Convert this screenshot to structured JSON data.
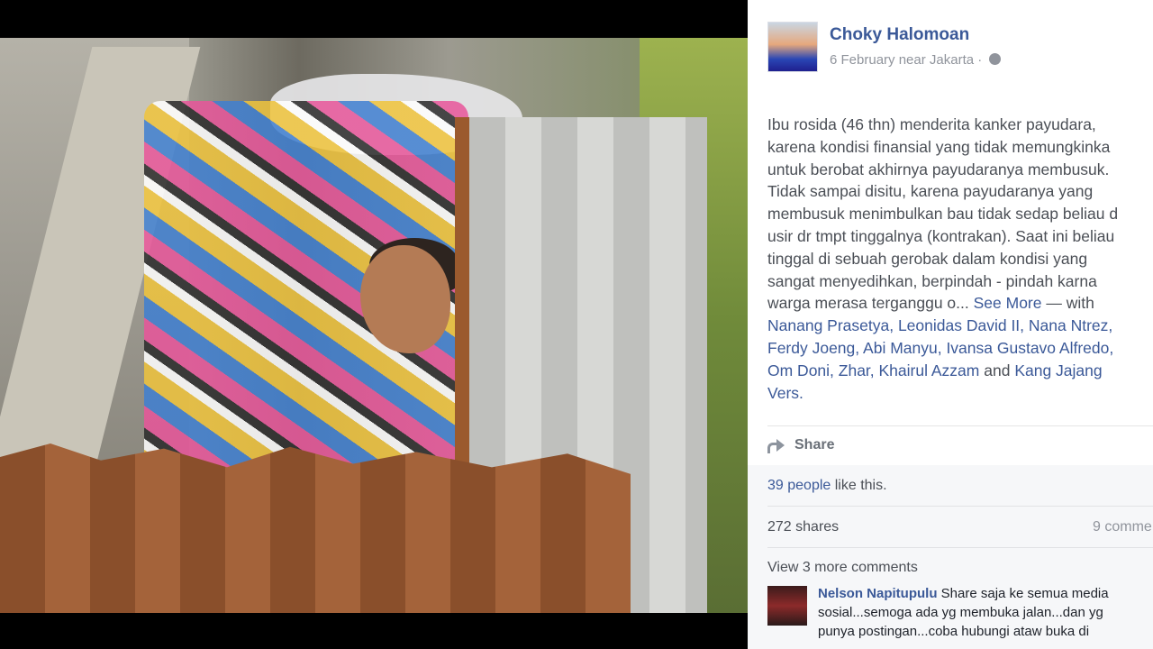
{
  "post": {
    "author": "Choky Halomoan",
    "meta": "6 February near Jakarta ·",
    "icon": "globe-icon",
    "text_lines": [
      "Ibu rosida (46 thn) menderita kanker payudara,",
      "karena kondisi finansial yang tidak memungkinka",
      "untuk berobat akhirnya payudaranya membusuk.",
      "Tidak sampai disitu, karena payudaranya yang",
      "membusuk menimbulkan bau tidak sedap beliau d",
      "usir dr tmpt tinggalnya (kontrakan). Saat ini beliau",
      "tinggal di sebuah gerobak dalam kondisi yang",
      "sangat menyedihkan, berpindah - pindah karna"
    ],
    "last_line_text": "warga merasa terganggu o...",
    "see_more": "See More",
    "with_label": "— with",
    "tags_line1": "Nanang Prasetya, Leonidas David II, Nana Ntrez,",
    "tags_line2": "Ferdy Joeng, Abi Manyu, Ivansa Gustavo Alfredo,",
    "tags_line3": "Om Doni, Zhar, Khairul Azzam",
    "and_label": "and",
    "tags_line3_end": "Kang Jajang",
    "tags_line4": "Vers."
  },
  "actions": {
    "share_label": "Share"
  },
  "ufi": {
    "likes_link": "39 people",
    "likes_text": "like this.",
    "shares": "272 shares",
    "comments_count": "9 comme",
    "view_more": "View 3 more comments"
  },
  "comment": {
    "author": "Nelson Napitupulu",
    "line1": "Share saja ke semua media",
    "line2": "sosial...semoga ada yg membuka jalan...dan yg",
    "line3": "punya postingan...coba hubungi ataw buka di"
  },
  "colors": {
    "link": "#3b5998",
    "text": "#4b4f56",
    "muted": "#90949c"
  }
}
